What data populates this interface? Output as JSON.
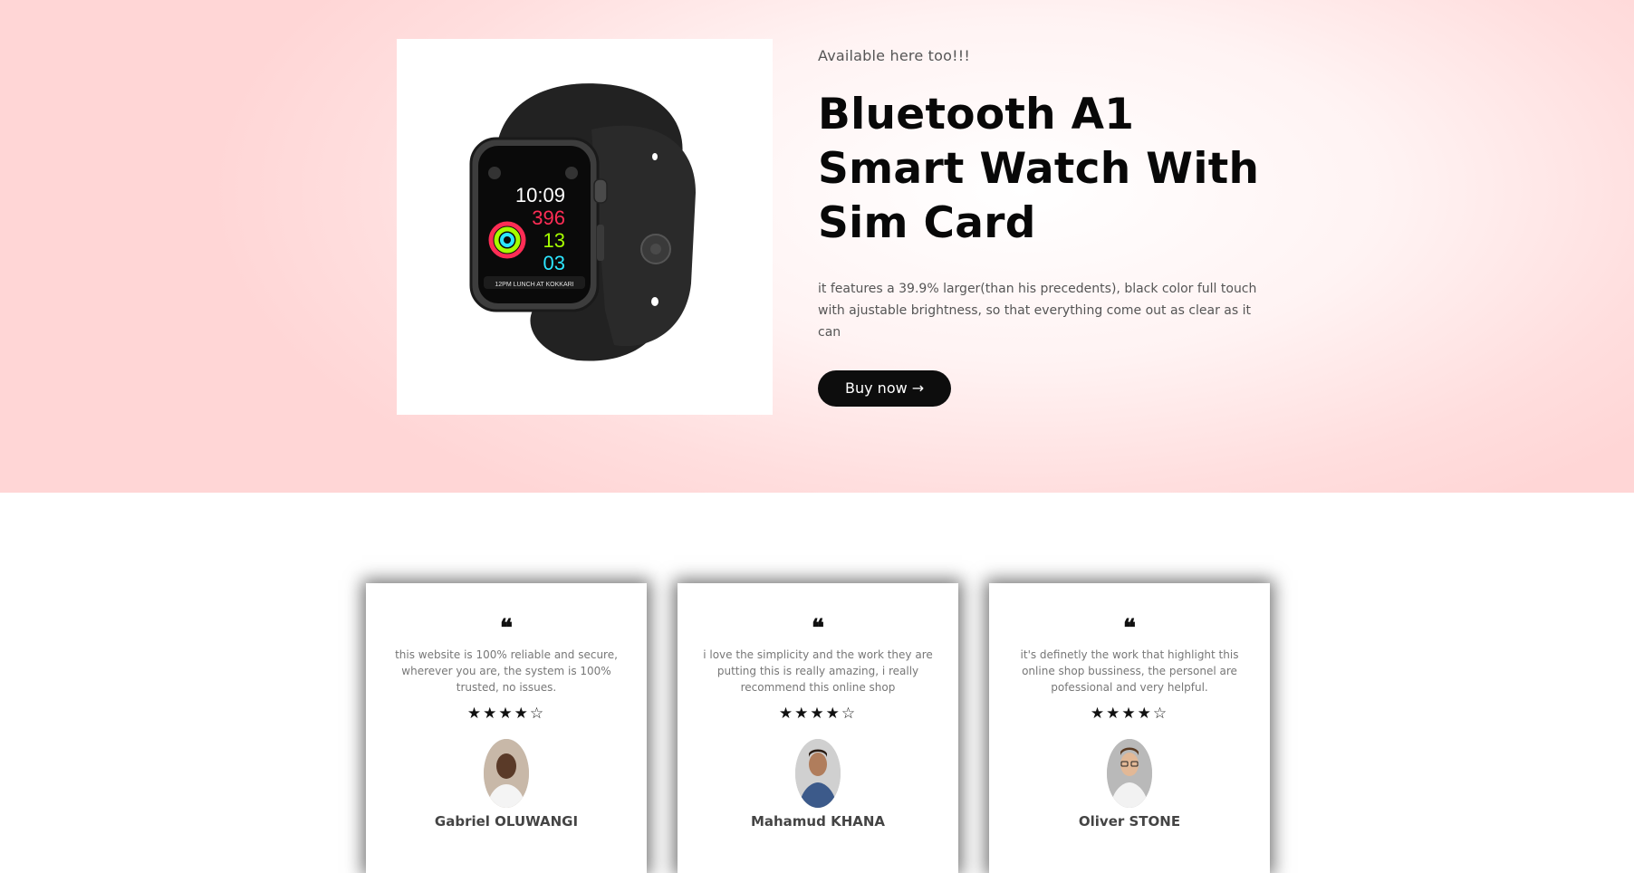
{
  "hero": {
    "eyebrow": "Available here too!!!",
    "title": "Bluetooth A1 Smart Watch With Sim Card",
    "description": "it features a 39.9% larger(than his precedents), black color full touch with ajustable brightness, so that everything come out as clear as it can",
    "buy_button": "Buy now →",
    "watch_screen": {
      "time": "10:09",
      "move": "396",
      "exercise": "13",
      "stand": "03",
      "event": "12PM LUNCH AT KOKKARI"
    }
  },
  "testimonials": [
    {
      "quote_icon": "quote-icon",
      "text": "this website is 100% reliable and secure, wherever you are, the system is 100% trusted, no issues.",
      "rating": 4,
      "stars": "★★★★☆",
      "name": "Gabriel OLUWANGI"
    },
    {
      "quote_icon": "quote-icon",
      "text": "i love the simplicity and the work they are putting this is really amazing, i really recommend this online shop",
      "rating": 4,
      "stars": "★★★★☆",
      "name": "Mahamud KHANA"
    },
    {
      "quote_icon": "quote-icon",
      "text": "it's definetly the work that highlight this online shop bussiness, the personel are pofessional and very helpful.",
      "rating": 4,
      "stars": "★★★★☆",
      "name": "Oliver STONE"
    }
  ],
  "colors": {
    "hero_bg": "#ffd6d6",
    "button_bg": "#0d0d0d",
    "title": "#080808"
  }
}
